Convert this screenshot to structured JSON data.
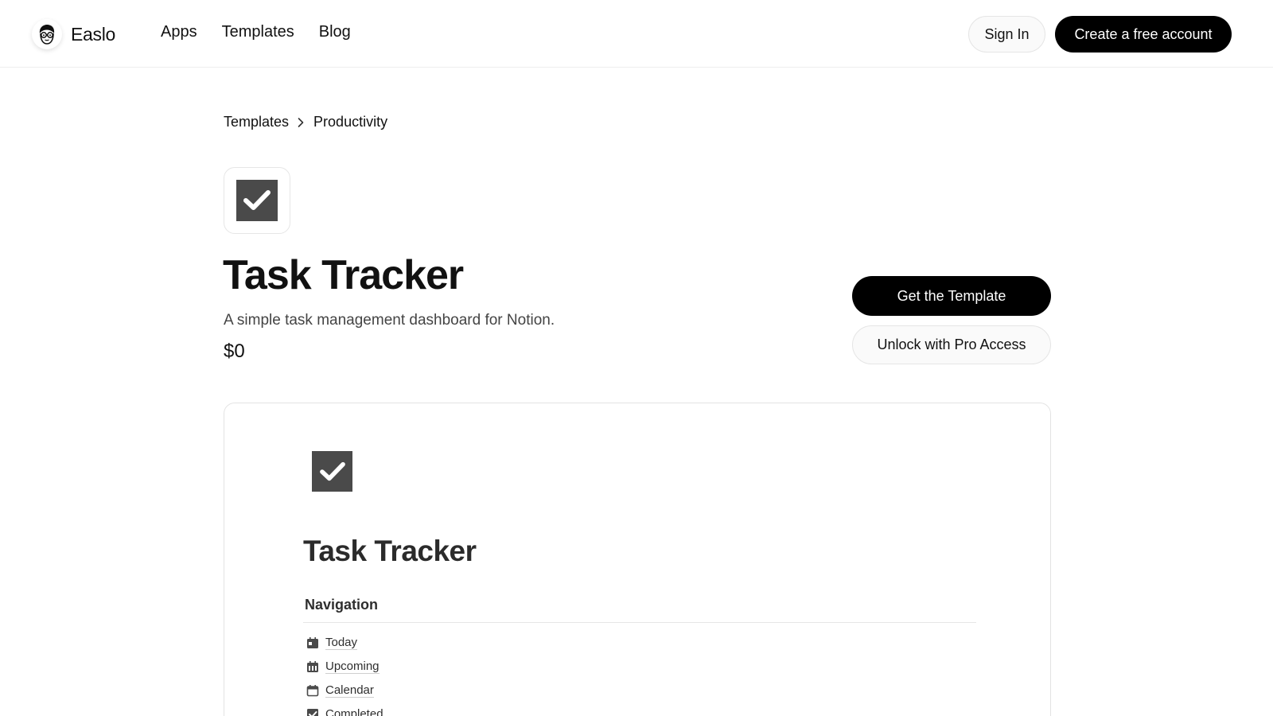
{
  "header": {
    "brand": "Easlo",
    "nav": [
      "Apps",
      "Templates",
      "Blog"
    ],
    "sign_in": "Sign In",
    "create_account": "Create a free account"
  },
  "breadcrumb": [
    "Templates",
    "Productivity"
  ],
  "product": {
    "title": "Task Tracker",
    "description": "A simple task management dashboard for Notion.",
    "price": "$0",
    "primary_button": "Get the Template",
    "secondary_button": "Unlock with Pro Access",
    "icon": "checkbox-checked-icon"
  },
  "preview": {
    "title": "Task Tracker",
    "section": "Navigation",
    "items": [
      {
        "label": "Today",
        "icon": "calendar-day-icon"
      },
      {
        "label": "Upcoming",
        "icon": "calendar-week-icon"
      },
      {
        "label": "Calendar",
        "icon": "calendar-icon"
      },
      {
        "label": "Completed",
        "icon": "checkbox-checked-icon"
      }
    ]
  },
  "colors": {
    "primary_button": "#000000",
    "icon_fill": "#4a4a4a",
    "border": "#e5e5e5"
  }
}
